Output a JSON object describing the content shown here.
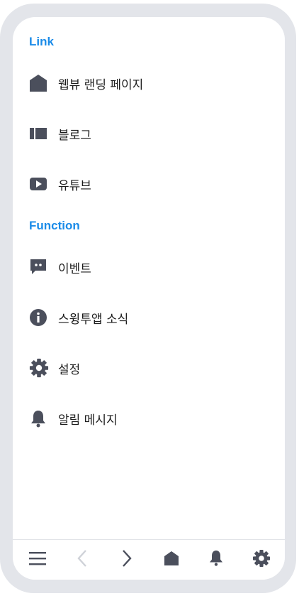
{
  "sections": [
    {
      "title": "Link",
      "items": [
        {
          "label": "웹뷰 랜딩 페이지",
          "icon": "home-icon"
        },
        {
          "label": "블로그",
          "icon": "blog-icon"
        },
        {
          "label": "유튜브",
          "icon": "youtube-icon"
        }
      ]
    },
    {
      "title": "Function",
      "items": [
        {
          "label": "이벤트",
          "icon": "chat-icon"
        },
        {
          "label": "스윙투앱 소식",
          "icon": "info-icon"
        },
        {
          "label": "설정",
          "icon": "gear-icon"
        },
        {
          "label": "알림 메시지",
          "icon": "bell-icon"
        }
      ]
    }
  ],
  "bottom_nav": [
    {
      "icon": "menu-icon",
      "enabled": true
    },
    {
      "icon": "back-icon",
      "enabled": false
    },
    {
      "icon": "forward-icon",
      "enabled": true
    },
    {
      "icon": "home-icon",
      "enabled": true
    },
    {
      "icon": "bell-icon",
      "enabled": true
    },
    {
      "icon": "gear-icon",
      "enabled": true
    }
  ],
  "colors": {
    "accent": "#1a8be8",
    "icon": "#4b4f5c",
    "icon_disabled": "#cfd2d8",
    "frame": "#e3e5ea"
  }
}
